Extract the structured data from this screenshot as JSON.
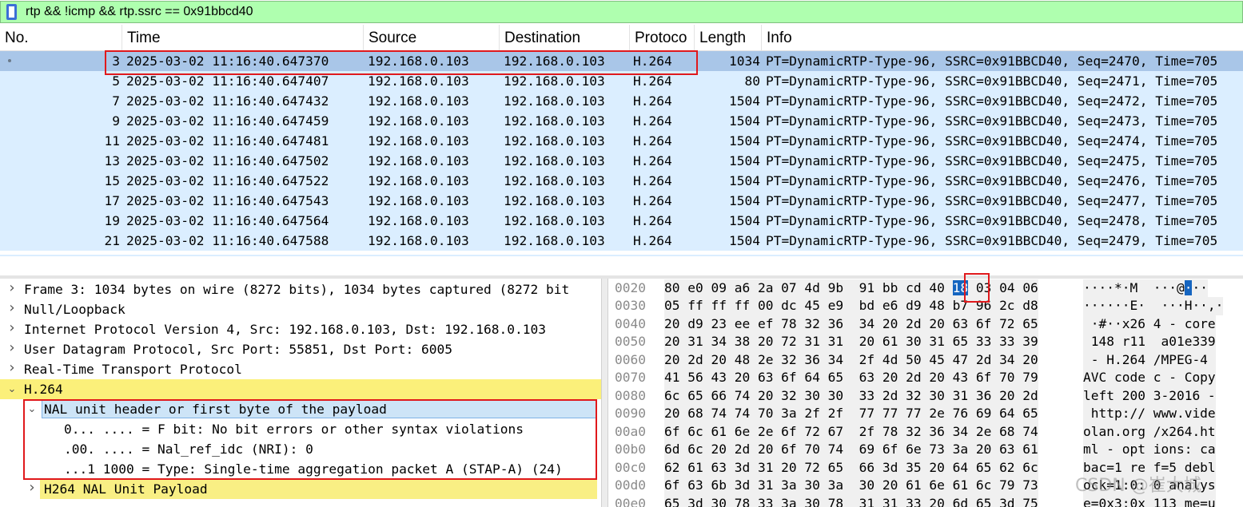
{
  "filter": {
    "value": "rtp && !icmp && rtp.ssrc == 0x91bbcd40",
    "icon": "bookmark-icon"
  },
  "columns": [
    "No.",
    "Time",
    "Source",
    "Destination",
    "Protoco",
    "Length",
    "Info"
  ],
  "packets": [
    {
      "no": "3",
      "time": "2025-03-02 11:16:40.647370",
      "src": "192.168.0.103",
      "dst": "192.168.0.103",
      "proto": "H.264",
      "len": "1034",
      "info": "PT=DynamicRTP-Type-96, SSRC=0x91BBCD40, Seq=2470, Time=705"
    },
    {
      "no": "5",
      "time": "2025-03-02 11:16:40.647407",
      "src": "192.168.0.103",
      "dst": "192.168.0.103",
      "proto": "H.264",
      "len": "80",
      "info": "PT=DynamicRTP-Type-96, SSRC=0x91BBCD40, Seq=2471, Time=705"
    },
    {
      "no": "7",
      "time": "2025-03-02 11:16:40.647432",
      "src": "192.168.0.103",
      "dst": "192.168.0.103",
      "proto": "H.264",
      "len": "1504",
      "info": "PT=DynamicRTP-Type-96, SSRC=0x91BBCD40, Seq=2472, Time=705"
    },
    {
      "no": "9",
      "time": "2025-03-02 11:16:40.647459",
      "src": "192.168.0.103",
      "dst": "192.168.0.103",
      "proto": "H.264",
      "len": "1504",
      "info": "PT=DynamicRTP-Type-96, SSRC=0x91BBCD40, Seq=2473, Time=705"
    },
    {
      "no": "11",
      "time": "2025-03-02 11:16:40.647481",
      "src": "192.168.0.103",
      "dst": "192.168.0.103",
      "proto": "H.264",
      "len": "1504",
      "info": "PT=DynamicRTP-Type-96, SSRC=0x91BBCD40, Seq=2474, Time=705"
    },
    {
      "no": "13",
      "time": "2025-03-02 11:16:40.647502",
      "src": "192.168.0.103",
      "dst": "192.168.0.103",
      "proto": "H.264",
      "len": "1504",
      "info": "PT=DynamicRTP-Type-96, SSRC=0x91BBCD40, Seq=2475, Time=705"
    },
    {
      "no": "15",
      "time": "2025-03-02 11:16:40.647522",
      "src": "192.168.0.103",
      "dst": "192.168.0.103",
      "proto": "H.264",
      "len": "1504",
      "info": "PT=DynamicRTP-Type-96, SSRC=0x91BBCD40, Seq=2476, Time=705"
    },
    {
      "no": "17",
      "time": "2025-03-02 11:16:40.647543",
      "src": "192.168.0.103",
      "dst": "192.168.0.103",
      "proto": "H.264",
      "len": "1504",
      "info": "PT=DynamicRTP-Type-96, SSRC=0x91BBCD40, Seq=2477, Time=705"
    },
    {
      "no": "19",
      "time": "2025-03-02 11:16:40.647564",
      "src": "192.168.0.103",
      "dst": "192.168.0.103",
      "proto": "H.264",
      "len": "1504",
      "info": "PT=DynamicRTP-Type-96, SSRC=0x91BBCD40, Seq=2478, Time=705"
    },
    {
      "no": "21",
      "time": "2025-03-02 11:16:40.647588",
      "src": "192.168.0.103",
      "dst": "192.168.0.103",
      "proto": "H.264",
      "len": "1504",
      "info": "PT=DynamicRTP-Type-96, SSRC=0x91BBCD40, Seq=2479, Time=705"
    }
  ],
  "details": [
    {
      "text": "Frame 3: 1034 bytes on wire (8272 bits), 1034 bytes captured (8272 bit",
      "expander": "collapsed"
    },
    {
      "text": "Null/Loopback",
      "expander": "collapsed"
    },
    {
      "text": "Internet Protocol Version 4, Src: 192.168.0.103, Dst: 192.168.0.103",
      "expander": "collapsed"
    },
    {
      "text": "User Datagram Protocol, Src Port: 55851, Dst Port: 6005",
      "expander": "collapsed"
    },
    {
      "text": "Real-Time Transport Protocol",
      "expander": "collapsed"
    },
    {
      "text": "H.264",
      "expander": "expanded"
    },
    {
      "text": "NAL unit header or first byte of the payload",
      "expander": "expanded"
    },
    {
      "text": "0... .... = F bit: No bit errors or other syntax violations",
      "expander": "none"
    },
    {
      "text": ".00. .... = Nal_ref_idc (NRI): 0",
      "expander": "none"
    },
    {
      "text": "...1 1000 = Type: Single-time aggregation packet A (STAP-A) (24)",
      "expander": "none"
    },
    {
      "text": "H264 NAL Unit Payload",
      "expander": "collapsed"
    }
  ],
  "bytes": [
    {
      "offset": "0020",
      "hex_pre": "80 e0 09 a6 2a 07 4d 9b  91 bb cd 40 ",
      "hex_hl": "18",
      "hex_post": " 03 04 06",
      "ascii_pre": "····*·M  ···",
      "ascii_hl": "@",
      "ascii_hl2": "·",
      "ascii_post": "··"
    },
    {
      "offset": "0030",
      "hex": "05 ff ff ff 00 dc 45 e9  bd e6 d9 48 b7 96 2c d8",
      "ascii": "······E·  ···H··,·"
    },
    {
      "offset": "0040",
      "hex": "20 d9 23 ee ef 78 32 36  34 20 2d 20 63 6f 72 65",
      "ascii": " ·#··x26 4 - core"
    },
    {
      "offset": "0050",
      "hex": "20 31 34 38 20 72 31 31  20 61 30 31 65 33 33 39",
      "ascii": " 148 r11  a01e339"
    },
    {
      "offset": "0060",
      "hex": "20 2d 20 48 2e 32 36 34  2f 4d 50 45 47 2d 34 20",
      "ascii": " - H.264 /MPEG-4 "
    },
    {
      "offset": "0070",
      "hex": "41 56 43 20 63 6f 64 65  63 20 2d 20 43 6f 70 79",
      "ascii": "AVC code c - Copy"
    },
    {
      "offset": "0080",
      "hex": "6c 65 66 74 20 32 30 30  33 2d 32 30 31 36 20 2d",
      "ascii": "left 200 3-2016 -"
    },
    {
      "offset": "0090",
      "hex": "20 68 74 74 70 3a 2f 2f  77 77 77 2e 76 69 64 65",
      "ascii": " http:// www.vide"
    },
    {
      "offset": "00a0",
      "hex": "6f 6c 61 6e 2e 6f 72 67  2f 78 32 36 34 2e 68 74",
      "ascii": "olan.org /x264.ht"
    },
    {
      "offset": "00b0",
      "hex": "6d 6c 20 2d 20 6f 70 74  69 6f 6e 73 3a 20 63 61",
      "ascii": "ml - opt ions: ca"
    },
    {
      "offset": "00c0",
      "hex": "62 61 63 3d 31 20 72 65  66 3d 35 20 64 65 62 6c",
      "ascii": "bac=1 re f=5 debl"
    },
    {
      "offset": "00d0",
      "hex": "6f 63 6b 3d 31 3a 30 3a  30 20 61 6e 61 6c 79 73",
      "ascii": "ock=1:0: 0 analys"
    },
    {
      "offset": "00e0",
      "hex": "65 3d 30 78 33 3a 30 78  31 31 33 20 6d 65 3d 75",
      "ascii": "e=0x3:0x 113 me=u"
    }
  ],
  "watermark": "CSDN @崔大城",
  "colors": {
    "filter_bg": "#afffaf",
    "row_bg": "#dbeeff",
    "selected_row_bg": "#a9c6e8",
    "h264_highlight": "#fbf07a",
    "selected_byte": "#1565c0",
    "annotation_red": "#e0191c"
  }
}
